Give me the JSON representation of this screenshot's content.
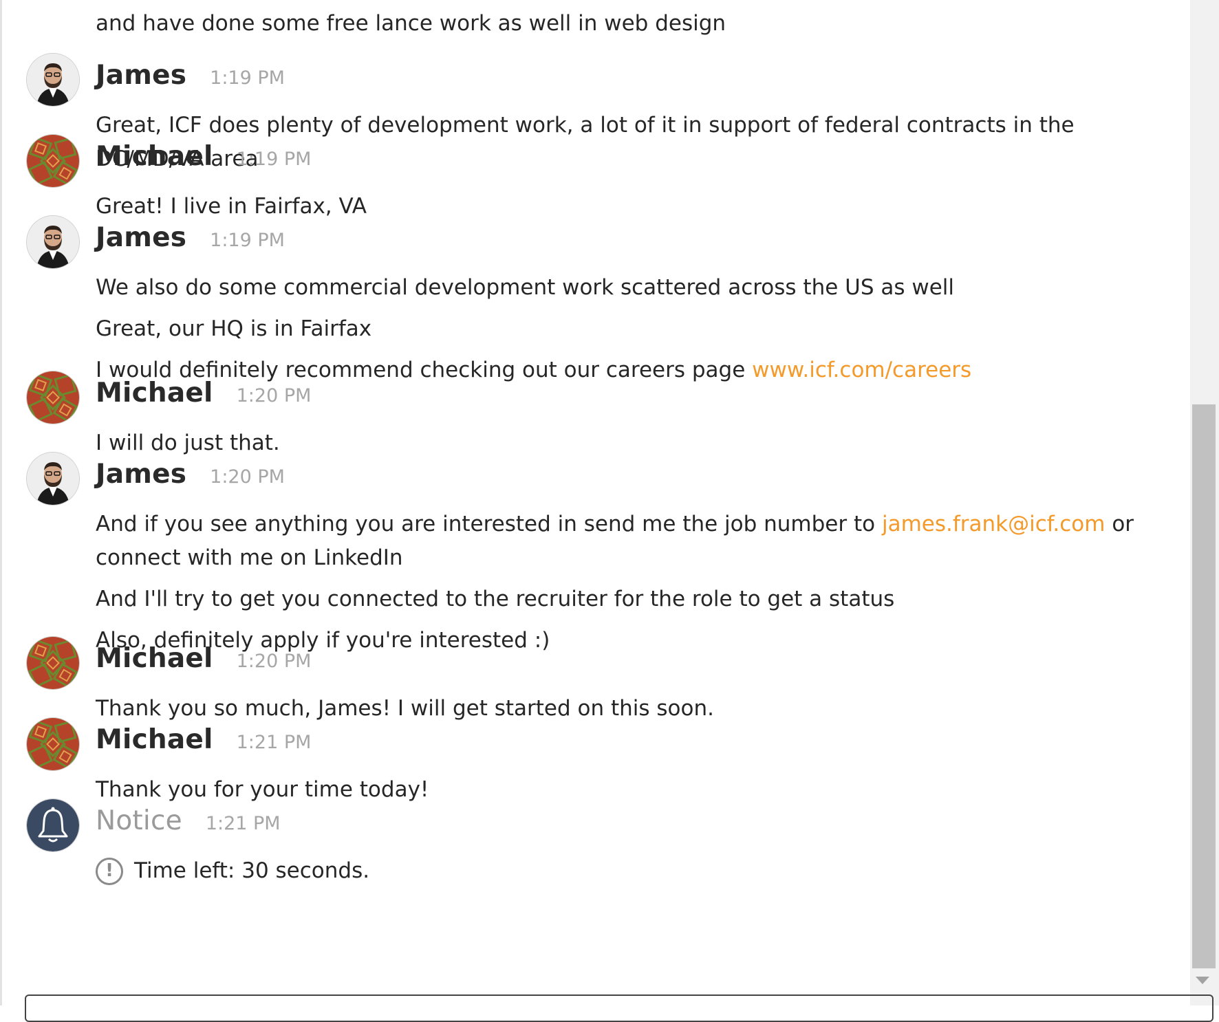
{
  "messages": [
    {
      "author": "",
      "time": "",
      "avatar": "",
      "lines": [
        "and have done some free lance work as well in web design"
      ]
    },
    {
      "author": "James",
      "time": "1:19 PM",
      "avatar": "james",
      "lines": [
        "Great, ICF does plenty of development work, a lot of it in support of federal contracts in the DC/MD/VA area"
      ]
    },
    {
      "author": "Michael",
      "time": "1:19 PM",
      "avatar": "michael",
      "lines": [
        "Great! I live in Fairfax, VA"
      ]
    },
    {
      "author": "James",
      "time": "1:19 PM",
      "avatar": "james",
      "lines": [
        "We also do some commercial development work scattered across the US as well",
        "Great, our HQ is in Fairfax"
      ],
      "link_line": {
        "before": "I would definitely recommend checking out our careers page ",
        "link": "www.icf.com/careers",
        "after": ""
      }
    },
    {
      "author": "Michael",
      "time": "1:20 PM",
      "avatar": "michael",
      "lines": [
        "I will do just that."
      ]
    },
    {
      "author": "James",
      "time": "1:20 PM",
      "avatar": "james",
      "link_line": {
        "before": "And if you see anything you are interested in send me the job number to ",
        "link": "james.frank@icf.com",
        "after": " or connect with me on LinkedIn"
      },
      "lines": [
        "And I'll try to get you connected to the recruiter for the role to get a status",
        "Also, definitely apply if you're interested :)"
      ]
    },
    {
      "author": "Michael",
      "time": "1:20 PM",
      "avatar": "michael",
      "lines": [
        "Thank you so much, James! I will get started on this soon."
      ]
    },
    {
      "author": "Michael",
      "time": "1:21 PM",
      "avatar": "michael",
      "lines": [
        "Thank you for your time today!"
      ]
    },
    {
      "author": "Notice",
      "time": "1:21 PM",
      "avatar": "bell",
      "lines": [
        "Time left: 30 seconds."
      ]
    }
  ],
  "icons": {
    "james_avatar": "user-avatar-photo",
    "michael_avatar": "user-avatar-pattern",
    "notice_avatar": "bell-icon",
    "alert": "exclamation-circle-icon"
  },
  "colors": {
    "link": "#f39a2b",
    "notice_avatar_bg": "#3a4a63"
  }
}
